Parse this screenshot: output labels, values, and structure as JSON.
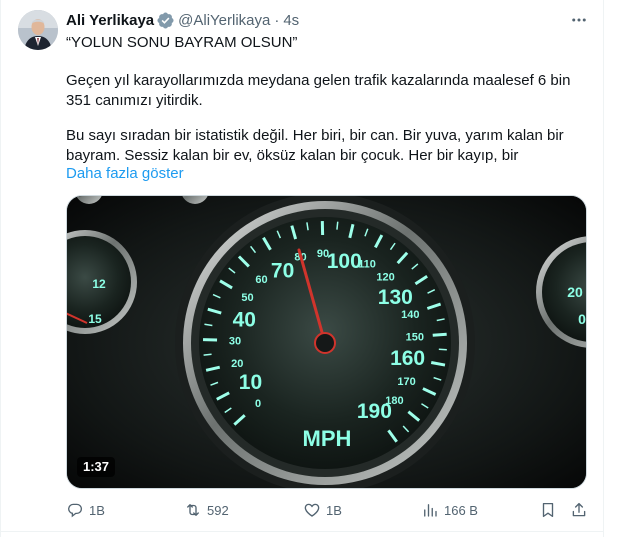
{
  "tweet": {
    "author_name": "Ali Yerlikaya",
    "handle": "@AliYerlikaya",
    "separator": "·",
    "time": "4s",
    "title_line": "“YOLUN SONU BAYRAM OLSUN”",
    "paragraph_1": "Geçen yıl karayollarımızda meydana gelen trafik kazalarında maalesef 6 bin 351 canımızı yitirdik.",
    "paragraph_2": "Bu sayı sıradan bir istatistik değil. Her biri, bir can. Bir yuva, yarım kalan bir bayram. Sessiz kalan bir ev, öksüz kalan bir çocuk. Her bir kayıp, bir",
    "show_more": "Daha fazla göster"
  },
  "media": {
    "duration": "1:37",
    "speedometer_unit": "MPH",
    "speedometer_labels": [
      "0",
      "10",
      "20",
      "30",
      "40",
      "50",
      "60",
      "70",
      "80",
      "90",
      "100",
      "110",
      "120",
      "130",
      "140",
      "150",
      "160",
      "170",
      "180",
      "190"
    ],
    "left_gauge_labels": [
      "12",
      "15"
    ],
    "right_gauge_labels": [
      "20",
      "0"
    ]
  },
  "actions": {
    "replies": "1B",
    "reposts": "592",
    "likes": "1B",
    "views": "166 B"
  },
  "colors": {
    "link": "#1d9bf0",
    "muted": "#536471",
    "verified": "#829aab",
    "gauge_glow": "#7fffe0",
    "needle": "#d0342c"
  },
  "icons": [
    "verified-badge-icon",
    "more-icon",
    "reply-icon",
    "repost-icon",
    "like-icon",
    "views-icon",
    "bookmark-icon",
    "share-icon"
  ]
}
